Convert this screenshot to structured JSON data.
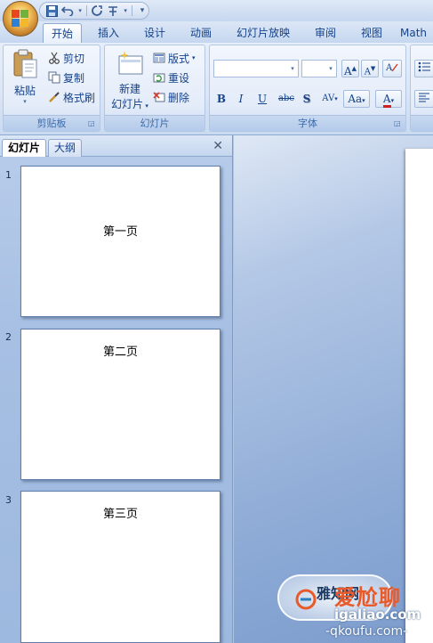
{
  "qat": {
    "save_icon": "save-icon",
    "undo_icon": "undo-icon",
    "redo_icon": "redo-icon",
    "format_icon": "format-icon",
    "customize_icon": "customize-qat-icon"
  },
  "tabs": [
    "开始",
    "插入",
    "设计",
    "动画",
    "幻灯片放映",
    "审阅",
    "视图",
    "Math"
  ],
  "active_tab": "开始",
  "ribbon": {
    "clipboard": {
      "label": "剪贴板",
      "paste": "粘贴",
      "cut": "剪切",
      "copy": "复制",
      "format_painter": "格式刷"
    },
    "slides": {
      "label": "幻灯片",
      "new_slide_line1": "新建",
      "new_slide_line2": "幻灯片",
      "layout": "版式",
      "reset": "重设",
      "delete": "删除"
    },
    "font": {
      "label": "字体",
      "grow": "A",
      "shrink": "A",
      "bold": "B",
      "italic": "I",
      "underline": "U",
      "strike": "abc",
      "shadow": "S",
      "spacing": "AV",
      "case": "Aa",
      "color": "A"
    }
  },
  "panel": {
    "tab_slides": "幻灯片",
    "tab_outline": "大纲",
    "close": "✕",
    "slides": [
      {
        "num": "1",
        "title": "第一页"
      },
      {
        "num": "2",
        "title": "第二页"
      },
      {
        "num": "3",
        "title": "第三页"
      }
    ]
  },
  "watermark": {
    "line1": "雅知网",
    "brand": "爱尬聊",
    "domain": "igaliao.com",
    "domain2": "-qkoufu.com-"
  },
  "colors": {
    "ribbon_text": "#15428b",
    "panel_bg": "#a6bfe3",
    "accent_orange": "#e85a2a"
  }
}
